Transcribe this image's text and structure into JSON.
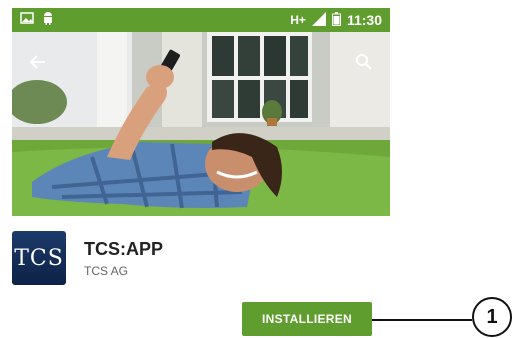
{
  "status_bar": {
    "network": "H+",
    "time": "11:30",
    "icons": [
      "image-icon",
      "android-icon",
      "signal-icon",
      "battery-icon"
    ]
  },
  "hero": {
    "back_icon": "arrow-left-icon",
    "search_icon": "search-icon"
  },
  "app": {
    "icon_text": "TCS",
    "title": "TCS:APP",
    "developer": "TCS AG"
  },
  "install_button": {
    "label": "INSTALLIEREN"
  },
  "callout": {
    "number": "1"
  },
  "colors": {
    "accent": "#5f9e2e",
    "app_icon": "#1c3a6b"
  }
}
